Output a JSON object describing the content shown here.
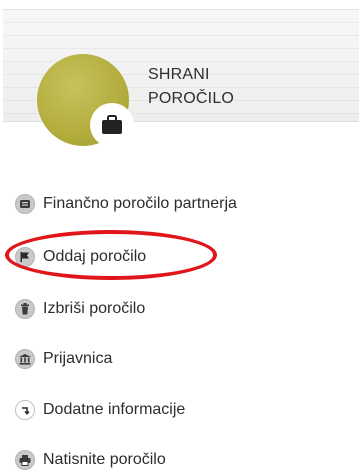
{
  "save_panel": {
    "title_line1": "SHRANI",
    "title_line2": "POROČILO",
    "icon": "briefcase-icon",
    "accent_color": "#b3ad3d"
  },
  "menu": {
    "items": [
      {
        "label": "Finančno poročilo partnerja",
        "icon": "document-icon"
      },
      {
        "label": "Oddaj poročilo",
        "icon": "flag-icon"
      },
      {
        "label": "Izbriši poročilo",
        "icon": "trash-icon"
      },
      {
        "label": "Prijavnica",
        "icon": "bank-icon"
      },
      {
        "label": "Dodatne informacije",
        "icon": "return-arrow-icon"
      },
      {
        "label": "Natisnite poročilo",
        "icon": "printer-icon"
      }
    ]
  },
  "highlight": {
    "color": "#e0161b"
  }
}
